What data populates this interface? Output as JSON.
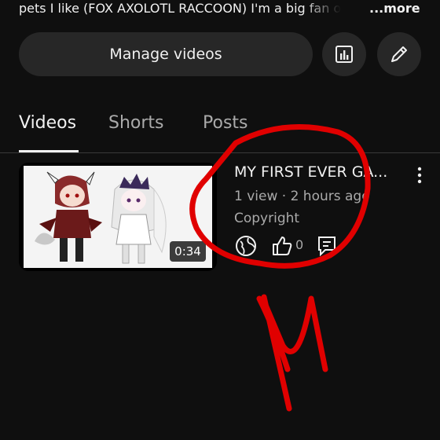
{
  "header": {
    "description": "pets I like (FOX AXOLOTL RACCOON) I'm a big fan o",
    "more_label": "...more"
  },
  "actions": {
    "manage_label": "Manage videos",
    "analytics_icon": "analytics-icon",
    "edit_icon": "pencil-icon"
  },
  "tabs": [
    {
      "label": "Videos",
      "active": true
    },
    {
      "label": "Shorts",
      "active": false
    },
    {
      "label": "Posts",
      "active": false
    }
  ],
  "video": {
    "title": "MY FIRST EVER GA...",
    "meta": "1 view · 2 hours ago",
    "status": "Copyright",
    "duration": "0:34",
    "likes": "0"
  },
  "colors": {
    "background": "#0f0f0f",
    "button": "#272727",
    "annotation": "#e00000"
  }
}
